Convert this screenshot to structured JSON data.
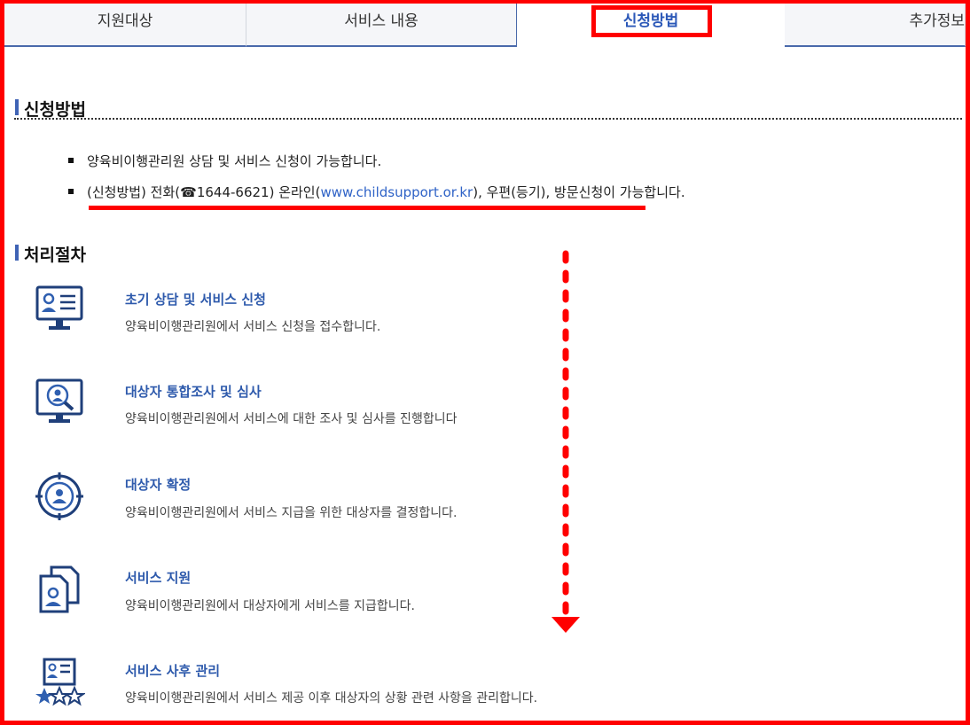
{
  "tabs": [
    {
      "label": "지원대상",
      "active": false
    },
    {
      "label": "서비스 내용",
      "active": false
    },
    {
      "label": "신청방법",
      "active": true
    },
    {
      "label": "추가정보",
      "active": false
    }
  ],
  "apply_section": {
    "title": "신청방법",
    "bullets": {
      "first": "양육비이행관리원 상담 및 서비스 신청이 가능합니다.",
      "second_prefix": "(신청방법) 전화(",
      "phone_icon": "☎",
      "phone": "1644-6621",
      "second_mid": ") 온라인(",
      "url": "www.childsupport.or.kr",
      "second_suffix": "), 우편(등기), 방문신청이 가능합니다."
    }
  },
  "process_section": {
    "title": "처리절차",
    "steps": [
      {
        "title": "초기 상담 및 서비스 신청",
        "desc": "양육비이행관리원에서 서비스 신청을 접수합니다.",
        "icon": "profile-monitor-icon"
      },
      {
        "title": "대상자 통합조사 및 심사",
        "desc": "양육비이행관리원에서 서비스에 대한 조사 및 심사를 진행합니다",
        "icon": "magnifier-monitor-icon"
      },
      {
        "title": "대상자 확정",
        "desc": "양육비이행관리원에서 서비스 지급을 위한 대상자를 결정합니다.",
        "icon": "target-user-icon"
      },
      {
        "title": "서비스 지원",
        "desc": "양육비이행관리원에서 대상자에게 서비스를 지급합니다.",
        "icon": "documents-user-icon"
      },
      {
        "title": "서비스 사후 관리",
        "desc": "양육비이행관리원에서 서비스 제공 이후 대상자의 상황 관련 사항을 관리합니다.",
        "icon": "rating-stars-icon"
      }
    ]
  },
  "colors": {
    "accent": "#2e5aac",
    "highlight": "#ff0000",
    "icon": "#1f3f7a"
  }
}
